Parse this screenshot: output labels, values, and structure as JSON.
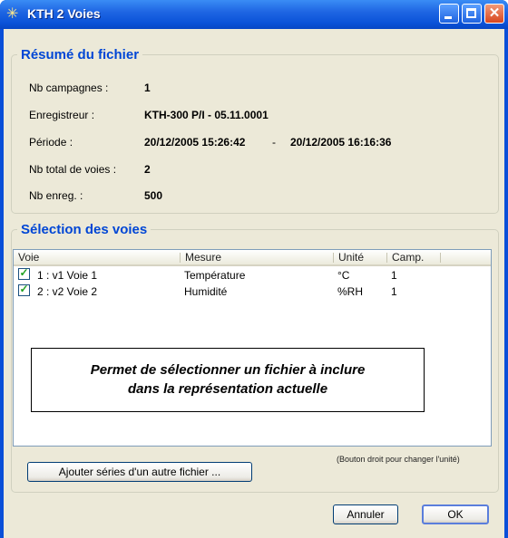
{
  "window": {
    "title": "KTH 2 Voies",
    "app_icon": "star-icon"
  },
  "summary": {
    "legend": "Résumé du fichier",
    "campaigns_label": "Nb campagnes :",
    "campaigns_value": "1",
    "recorder_label": "Enregistreur :",
    "recorder_value": "KTH-300 P/I - 05.11.0001",
    "period_label": "Période :",
    "period_start": "20/12/2005 15:26:42",
    "period_sep": "-",
    "period_end": "20/12/2005 16:16:36",
    "total_channels_label": "Nb total de voies :",
    "total_channels_value": "2",
    "records_label": "Nb enreg. :",
    "records_value": "500"
  },
  "selection": {
    "legend": "Sélection des voies",
    "columns": [
      "Voie",
      "Mesure",
      "Unité",
      "Camp."
    ],
    "rows": [
      {
        "checked": true,
        "voie": "1 : v1 Voie 1",
        "mesure": "Température",
        "unite": "°C",
        "camp": "1"
      },
      {
        "checked": true,
        "voie": "2 : v2 Voie 2",
        "mesure": "Humidité",
        "unite": "%RH",
        "camp": "1"
      }
    ],
    "note_line1": "Permet de sélectionner un fichier à inclure",
    "note_line2": "dans la représentation actuelle",
    "hint": "(Bouton droit pour changer l'unité)",
    "add_button": "Ajouter séries d'un autre fichier ..."
  },
  "buttons": {
    "cancel": "Annuler",
    "ok": "OK"
  },
  "colors": {
    "titlebar": "#0a52d8",
    "legend": "#0046d5",
    "face": "#ece9d8"
  }
}
